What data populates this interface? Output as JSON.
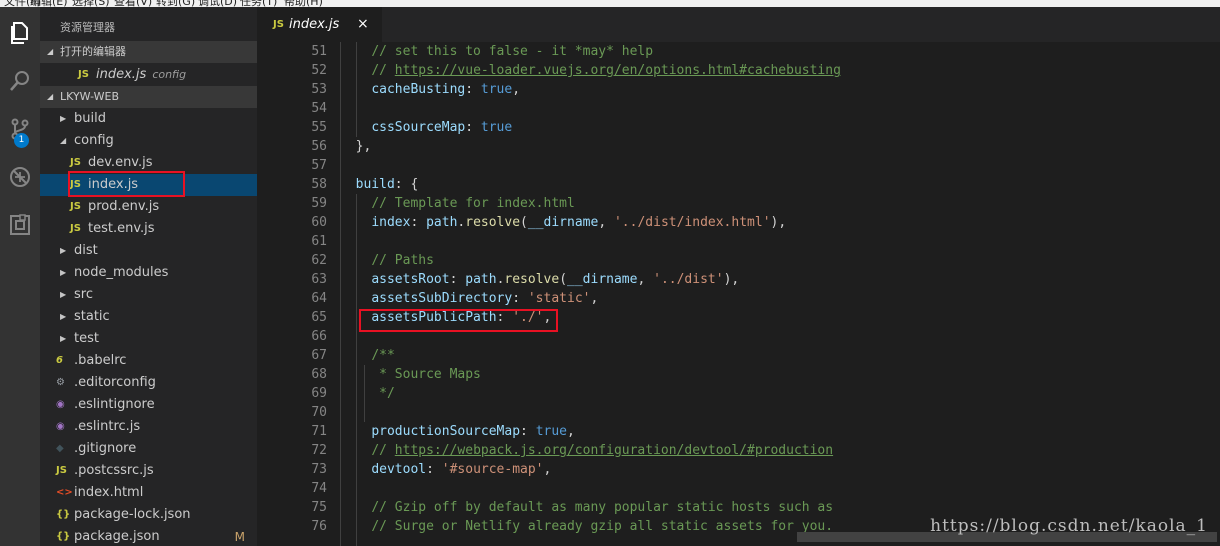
{
  "menubar": [
    "文件(F)",
    "编辑(E)",
    "选择(S)",
    "查看(V)",
    "转到(G)",
    "调试(D)",
    "任务(T)",
    "帮助(H)"
  ],
  "activity_bar": {
    "icons": [
      "explorer-icon",
      "search-icon",
      "source-control-icon",
      "debug-icon",
      "extensions-icon"
    ],
    "source_control_badge": "1"
  },
  "sidebar": {
    "title": "资源管理器",
    "open_editors": {
      "header": "打开的编辑器",
      "items": [
        {
          "name": "index.js",
          "description": "config"
        }
      ]
    },
    "project": {
      "header": "LKYW-WEB",
      "tree": [
        {
          "label": "build",
          "type": "folder",
          "expanded": false,
          "depth": 0
        },
        {
          "label": "config",
          "type": "folder",
          "expanded": true,
          "depth": 0
        },
        {
          "label": "dev.env.js",
          "type": "js",
          "depth": 1
        },
        {
          "label": "index.js",
          "type": "js",
          "depth": 1,
          "selected": true
        },
        {
          "label": "prod.env.js",
          "type": "js",
          "depth": 1
        },
        {
          "label": "test.env.js",
          "type": "js",
          "depth": 1
        },
        {
          "label": "dist",
          "type": "folder",
          "expanded": false,
          "depth": 0
        },
        {
          "label": "node_modules",
          "type": "folder",
          "expanded": false,
          "depth": 0
        },
        {
          "label": "src",
          "type": "folder",
          "expanded": false,
          "depth": 0
        },
        {
          "label": "static",
          "type": "folder",
          "expanded": false,
          "depth": 0
        },
        {
          "label": "test",
          "type": "folder",
          "expanded": false,
          "depth": 0
        },
        {
          "label": ".babelrc",
          "type": "babel",
          "depth": 0
        },
        {
          "label": ".editorconfig",
          "type": "gear",
          "depth": 0
        },
        {
          "label": ".eslintignore",
          "type": "eslint",
          "depth": 0
        },
        {
          "label": ".eslintrc.js",
          "type": "eslint",
          "depth": 0
        },
        {
          "label": ".gitignore",
          "type": "git",
          "depth": 0
        },
        {
          "label": ".postcssrc.js",
          "type": "js",
          "depth": 0
        },
        {
          "label": "index.html",
          "type": "html",
          "depth": 0
        },
        {
          "label": "package-lock.json",
          "type": "json",
          "depth": 0
        },
        {
          "label": "package.json",
          "type": "json",
          "depth": 0,
          "badge": "M"
        }
      ]
    }
  },
  "editor": {
    "tab": {
      "label": "index.js",
      "close": "×",
      "icon": "JS"
    },
    "lines": [
      {
        "n": "51",
        "t": [
          [
            "    ",
            ""
          ],
          [
            "// set this to false - it *may* help",
            "comment"
          ]
        ]
      },
      {
        "n": "52",
        "t": [
          [
            "    ",
            ""
          ],
          [
            "// ",
            "comment"
          ],
          [
            "https://vue-loader.vuejs.org/en/options.html#cachebusting",
            "link"
          ]
        ]
      },
      {
        "n": "53",
        "t": [
          [
            "    ",
            ""
          ],
          [
            "cacheBusting",
            "prop"
          ],
          [
            ": ",
            "punc"
          ],
          [
            "true",
            "kw"
          ],
          [
            ",",
            "punc"
          ]
        ]
      },
      {
        "n": "54",
        "t": []
      },
      {
        "n": "55",
        "t": [
          [
            "    ",
            ""
          ],
          [
            "cssSourceMap",
            "prop"
          ],
          [
            ": ",
            "punc"
          ],
          [
            "true",
            "kw"
          ]
        ]
      },
      {
        "n": "56",
        "t": [
          [
            "  ",
            ""
          ],
          [
            "},",
            "punc"
          ]
        ]
      },
      {
        "n": "57",
        "t": []
      },
      {
        "n": "58",
        "t": [
          [
            "  ",
            ""
          ],
          [
            "build",
            "prop"
          ],
          [
            ": {",
            "punc"
          ]
        ]
      },
      {
        "n": "59",
        "t": [
          [
            "    ",
            ""
          ],
          [
            "// Template for index.html",
            "comment"
          ]
        ]
      },
      {
        "n": "60",
        "t": [
          [
            "    ",
            ""
          ],
          [
            "index",
            "prop"
          ],
          [
            ": ",
            "punc"
          ],
          [
            "path",
            "prop"
          ],
          [
            ".",
            "punc"
          ],
          [
            "resolve",
            "fn"
          ],
          [
            "(",
            "punc"
          ],
          [
            "__dirname",
            "prop"
          ],
          [
            ", ",
            "punc"
          ],
          [
            "'../dist/index.html'",
            "str"
          ],
          [
            "),",
            "punc"
          ]
        ]
      },
      {
        "n": "61",
        "t": []
      },
      {
        "n": "62",
        "t": [
          [
            "    ",
            ""
          ],
          [
            "// Paths",
            "comment"
          ]
        ]
      },
      {
        "n": "63",
        "t": [
          [
            "    ",
            ""
          ],
          [
            "assetsRoot",
            "prop"
          ],
          [
            ": ",
            "punc"
          ],
          [
            "path",
            "prop"
          ],
          [
            ".",
            "punc"
          ],
          [
            "resolve",
            "fn"
          ],
          [
            "(",
            "punc"
          ],
          [
            "__dirname",
            "prop"
          ],
          [
            ", ",
            "punc"
          ],
          [
            "'../dist'",
            "str"
          ],
          [
            "),",
            "punc"
          ]
        ]
      },
      {
        "n": "64",
        "t": [
          [
            "    ",
            ""
          ],
          [
            "assetsSubDirectory",
            "prop"
          ],
          [
            ": ",
            "punc"
          ],
          [
            "'static'",
            "str"
          ],
          [
            ",",
            "punc"
          ]
        ]
      },
      {
        "n": "65",
        "t": [
          [
            "    ",
            ""
          ],
          [
            "assetsPublicPath",
            "prop"
          ],
          [
            ": ",
            "punc"
          ],
          [
            "'./'",
            "str"
          ],
          [
            ",",
            "punc"
          ]
        ]
      },
      {
        "n": "66",
        "t": []
      },
      {
        "n": "67",
        "t": [
          [
            "    ",
            ""
          ],
          [
            "/**",
            "comment"
          ]
        ]
      },
      {
        "n": "68",
        "t": [
          [
            "     ",
            ""
          ],
          [
            "* Source Maps",
            "comment"
          ]
        ]
      },
      {
        "n": "69",
        "t": [
          [
            "     ",
            ""
          ],
          [
            "*/",
            "comment"
          ]
        ]
      },
      {
        "n": "70",
        "t": []
      },
      {
        "n": "71",
        "t": [
          [
            "    ",
            ""
          ],
          [
            "productionSourceMap",
            "prop"
          ],
          [
            ": ",
            "punc"
          ],
          [
            "true",
            "kw"
          ],
          [
            ",",
            "punc"
          ]
        ]
      },
      {
        "n": "72",
        "t": [
          [
            "    ",
            ""
          ],
          [
            "// ",
            "comment"
          ],
          [
            "https://webpack.js.org/configuration/devtool/#production",
            "link"
          ]
        ]
      },
      {
        "n": "73",
        "t": [
          [
            "    ",
            ""
          ],
          [
            "devtool",
            "prop"
          ],
          [
            ": ",
            "punc"
          ],
          [
            "'#source-map'",
            "str"
          ],
          [
            ",",
            "punc"
          ]
        ]
      },
      {
        "n": "74",
        "t": []
      },
      {
        "n": "75",
        "t": [
          [
            "    ",
            ""
          ],
          [
            "// Gzip off by default as many popular static hosts such as",
            "comment"
          ]
        ]
      },
      {
        "n": "76",
        "t": [
          [
            "    ",
            ""
          ],
          [
            "// Surge or Netlify already gzip all static assets for you.",
            "comment"
          ]
        ]
      }
    ]
  },
  "watermark": "https://blog.csdn.net/kaola_1",
  "colors": {
    "selection": "#094771",
    "highlight_box": "#e81123",
    "accent": "#007acc"
  }
}
